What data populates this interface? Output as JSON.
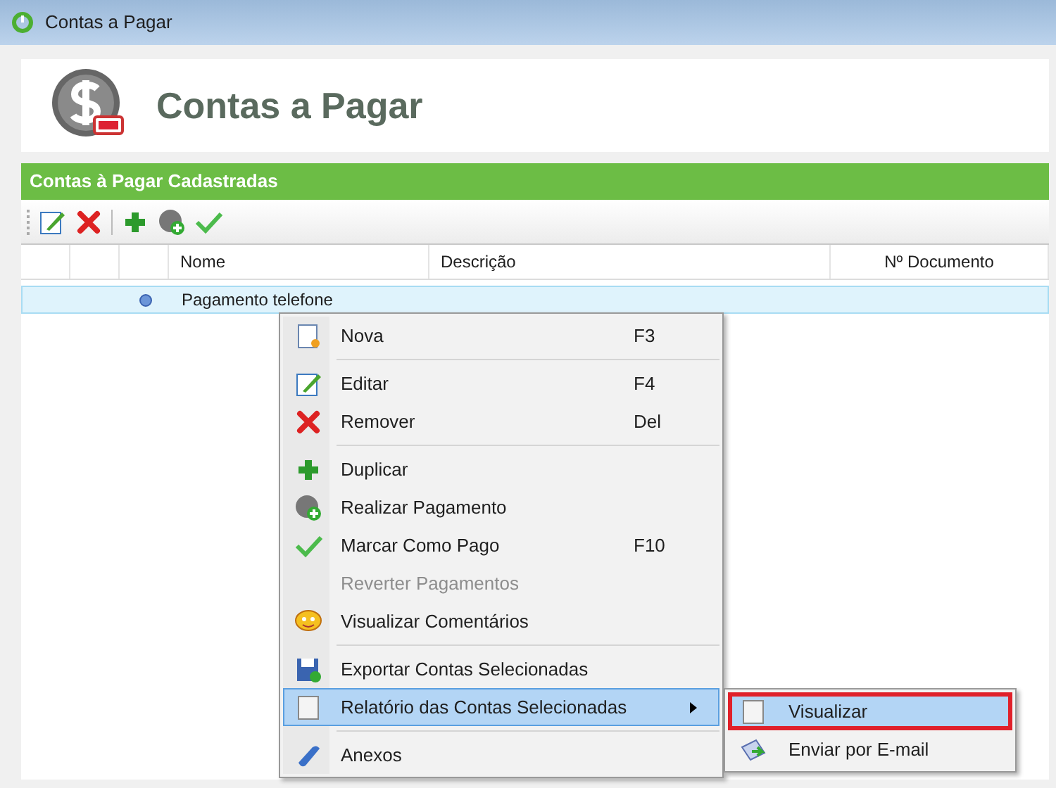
{
  "window": {
    "title": "Contas a Pagar"
  },
  "header": {
    "title": "Contas a Pagar"
  },
  "section": {
    "title": "Contas à Pagar Cadastradas"
  },
  "table": {
    "columns": [
      "Nome",
      "Descrição",
      "Nº Documento"
    ],
    "rows": [
      {
        "nome": "Pagamento telefone",
        "selected": true
      }
    ]
  },
  "context_menu": {
    "items": [
      {
        "kind": "item",
        "label": "Nova",
        "shortcut": "F3",
        "disabled": false,
        "selected": false
      },
      {
        "kind": "separator"
      },
      {
        "kind": "item",
        "label": "Editar",
        "shortcut": "F4",
        "disabled": false,
        "selected": false
      },
      {
        "kind": "item",
        "label": "Remover",
        "shortcut": "Del",
        "disabled": false,
        "selected": false
      },
      {
        "kind": "separator"
      },
      {
        "kind": "item",
        "label": "Duplicar",
        "disabled": false,
        "selected": false
      },
      {
        "kind": "item",
        "label": "Realizar Pagamento",
        "disabled": false,
        "selected": false
      },
      {
        "kind": "item",
        "label": "Marcar Como Pago",
        "shortcut": "F10",
        "disabled": false,
        "selected": false
      },
      {
        "kind": "item",
        "label": "Reverter Pagamentos",
        "disabled": true,
        "selected": false
      },
      {
        "kind": "item",
        "label": "Visualizar Comentários",
        "disabled": false,
        "selected": false
      },
      {
        "kind": "separator"
      },
      {
        "kind": "item",
        "label": "Exportar Contas Selecionadas",
        "disabled": false,
        "selected": false
      },
      {
        "kind": "item",
        "label": "Relatório das Contas Selecionadas",
        "disabled": false,
        "selected": true,
        "submenu": true
      },
      {
        "kind": "separator"
      },
      {
        "kind": "item",
        "label": "Anexos",
        "disabled": false,
        "selected": false
      }
    ]
  },
  "submenu": {
    "items": [
      {
        "label": "Visualizar",
        "selected": true,
        "highlighted": true
      },
      {
        "label": "Enviar por E-mail",
        "selected": false,
        "highlighted": false
      }
    ]
  }
}
